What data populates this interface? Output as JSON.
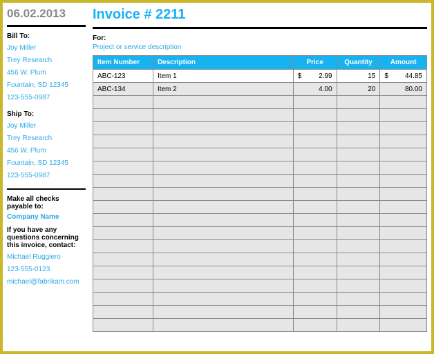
{
  "header": {
    "date": "06.02.2013",
    "invoice_title": "Invoice # 2211"
  },
  "sidebar": {
    "bill_to_label": "Bill To:",
    "bill_to": {
      "name": "Joy Miller",
      "company": "Trey Research",
      "street": "456 W. Plum",
      "city": "Fountain, SD 12345",
      "phone": "123-555-0987"
    },
    "ship_to_label": "Ship To:",
    "ship_to": {
      "name": "Joy Miller",
      "company": "Trey Research",
      "street": "456 W. Plum",
      "city": "Fountain, SD 12345",
      "phone": "123-555-0987"
    },
    "checks_label": "Make all checks payable to:",
    "company_name": "Company Name",
    "questions_label": "If you have any questions concerning this invoice, contact:",
    "contact": {
      "name": "Michael Ruggiero",
      "phone": "123-555-0123",
      "email": "michael@fabrikam.com"
    }
  },
  "main": {
    "for_label": "For:",
    "for_desc": "Project or service description",
    "columns": {
      "item": "Item Number",
      "desc": "Description",
      "price": "Price",
      "qty": "Quantity",
      "amount": "Amount"
    },
    "rows": [
      {
        "item": "ABC-123",
        "desc": "Item 1",
        "price_sym": "$",
        "price": "2.99",
        "qty": "15",
        "amt_sym": "$",
        "amount": "44.85"
      },
      {
        "item": "ABC-134",
        "desc": "Item 2",
        "price_sym": "",
        "price": "4.00",
        "qty": "20",
        "amt_sym": "",
        "amount": "80.00"
      }
    ]
  },
  "chart_data": {
    "type": "table",
    "title": "Invoice # 2211",
    "columns": [
      "Item Number",
      "Description",
      "Price",
      "Quantity",
      "Amount"
    ],
    "rows": [
      [
        "ABC-123",
        "Item 1",
        2.99,
        15,
        44.85
      ],
      [
        "ABC-134",
        "Item 2",
        4.0,
        20,
        80.0
      ]
    ]
  }
}
